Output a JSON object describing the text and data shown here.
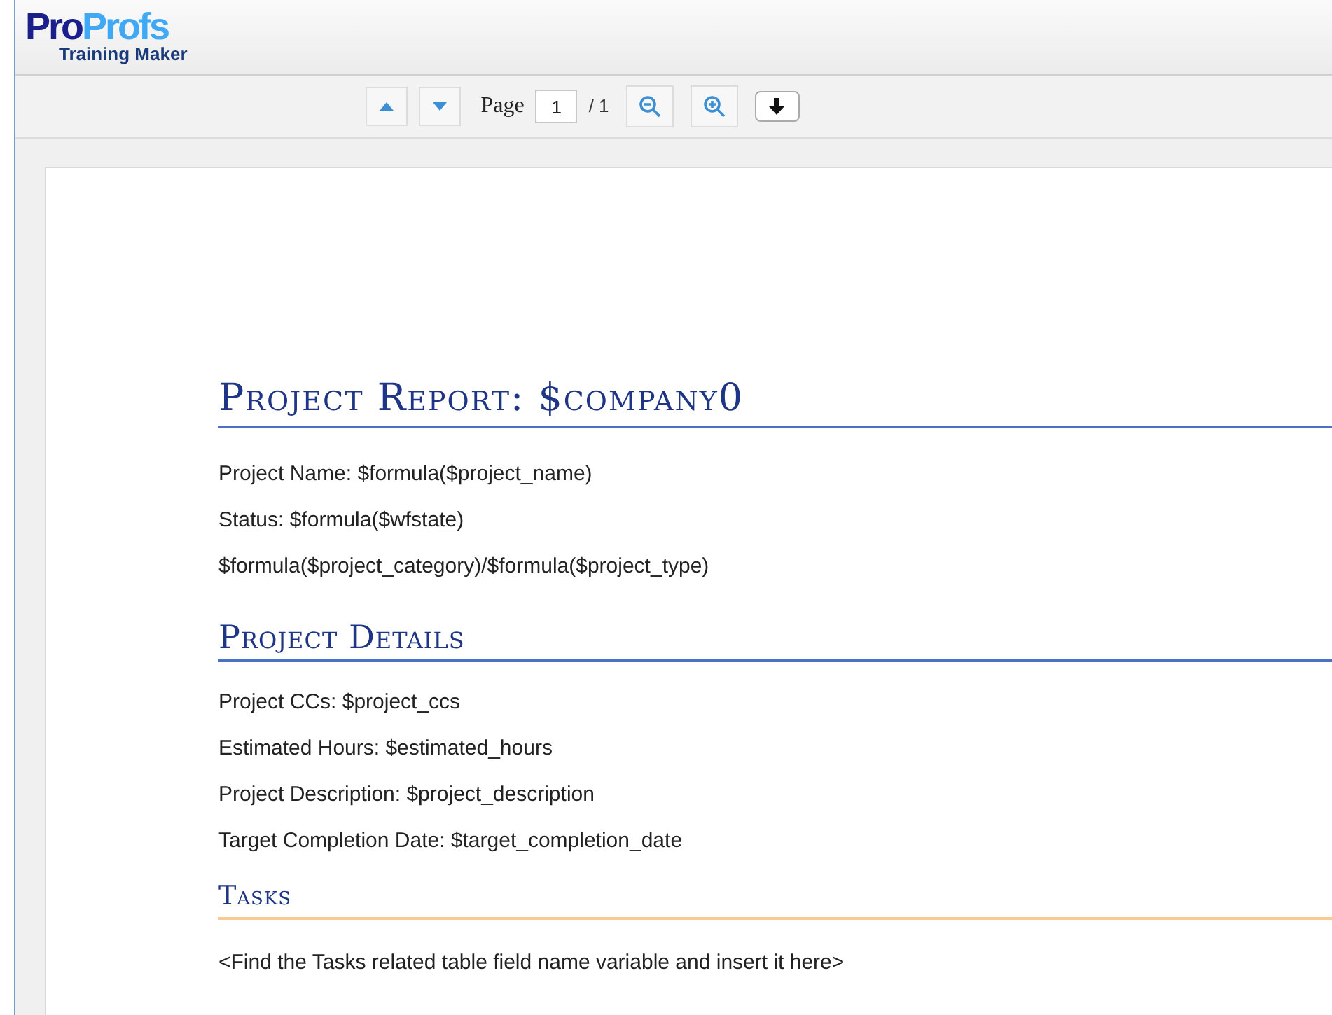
{
  "header": {
    "logo": {
      "part1": "Pro",
      "part2": "Profs",
      "subtitle": "Training Maker"
    }
  },
  "toolbar": {
    "page_label": "Page",
    "page_value": "1",
    "page_total": "/ 1"
  },
  "document": {
    "sections": [
      {
        "kind": "title",
        "heading": "Project Report: $company0",
        "lines": [
          "Project Name: $formula($project_name)",
          "Status: $formula($wfstate)",
          "$formula($project_category)/$formula($project_type)"
        ]
      },
      {
        "kind": "heading1",
        "heading": "Project Details",
        "lines": [
          "Project CCs: $project_ccs",
          "Estimated Hours: $estimated_hours",
          "Project Description: $project_description",
          "Target Completion Date: $target_completion_date"
        ]
      },
      {
        "kind": "heading2",
        "heading": "Tasks",
        "lines": [
          "<Find the Tasks related table field name variable and insert it here>"
        ]
      }
    ]
  }
}
